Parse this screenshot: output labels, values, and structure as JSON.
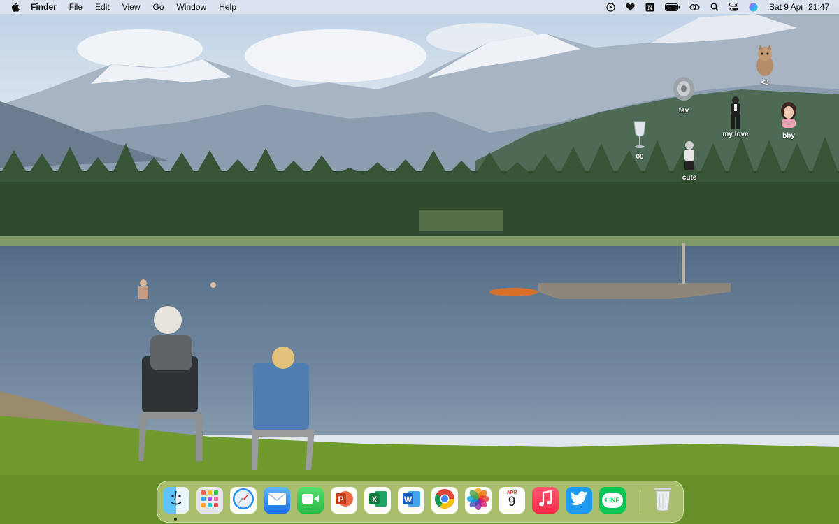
{
  "menubar": {
    "app_name": "Finder",
    "menus": [
      "File",
      "Edit",
      "View",
      "Go",
      "Window",
      "Help"
    ],
    "status_icons": [
      "play-circle-icon",
      "heart-icon",
      "notion-icon",
      "battery-icon",
      "link-icon",
      "search-icon",
      "control-center-icon",
      "siri-icon"
    ],
    "clock": "Sat 9 Apr  21:47"
  },
  "desktop_icons": [
    {
      "name": "<3",
      "icon": "cat-photo-icon"
    },
    {
      "name": "fav",
      "icon": "shell-photo-icon"
    },
    {
      "name": "my love",
      "icon": "suit-man-photo-icon"
    },
    {
      "name": "bby",
      "icon": "portrait-photo-icon"
    },
    {
      "name": "00",
      "icon": "glass-photo-icon"
    },
    {
      "name": "cute",
      "icon": "figure-photo-icon"
    }
  ],
  "dock": {
    "apps": [
      "Finder",
      "Launchpad",
      "Safari",
      "Mail",
      "FaceTime",
      "PowerPoint",
      "Excel",
      "Word",
      "Chrome",
      "Photos",
      "Calendar",
      "Music",
      "Twitter",
      "LINE"
    ],
    "calendar": {
      "month": "APR",
      "day": "9"
    },
    "excel_letter": "X",
    "word_letter": "W",
    "ppt_letter": "P",
    "line_text": "LINE",
    "trash": "Trash",
    "running": [
      "Finder"
    ]
  }
}
